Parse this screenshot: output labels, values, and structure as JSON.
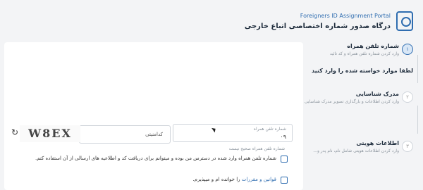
{
  "header": {
    "portal_name": "Foreigners ID Assignment Portal",
    "title": "درگاه صدور شماره اختصاصی اتباع خارجی"
  },
  "steps": [
    {
      "number": "۱",
      "title": "شماره تلفن همراه",
      "subtitle": "وارد کردن شماره تلفن همراه و کد تائید",
      "state": "active"
    },
    {
      "number": "۲",
      "title": "مدرک شناسایی",
      "subtitle": "وارد کردن اطلاعات و بارگذاری تصویر مدرک شناسایی",
      "state": "idle"
    },
    {
      "number": "۳",
      "title": "اطلاعات هویتی",
      "subtitle": "وارد کردن اطلاعات هویتی شامل نام، نام پدر و...",
      "state": "idle"
    }
  ],
  "form": {
    "heading": "لطفا موارد خواسته شده را وارد کنید",
    "phone_label": "شماره تلفن همراه",
    "phone_value": "۰۹",
    "phone_hint": "شماره تلفن همراه صحیح نیست",
    "captcha_placeholder": "کدامنیتی",
    "captcha_text": "W8EX",
    "consent_text": "شماره تلفن همراه وارد شده در دسترس من بوده و میتوانم برای دریافت کد و اطلاعیه های ارسالی از آن استفاده کنم.",
    "terms_link": "قوانین و مقررات",
    "terms_suffix": "را خوانده ام و میپذیرم."
  },
  "colors": {
    "accent": "#2f6db0",
    "background": "#f3f4f6"
  },
  "icons": {
    "logo": "portal-logo-icon",
    "refresh": "refresh-icon"
  }
}
